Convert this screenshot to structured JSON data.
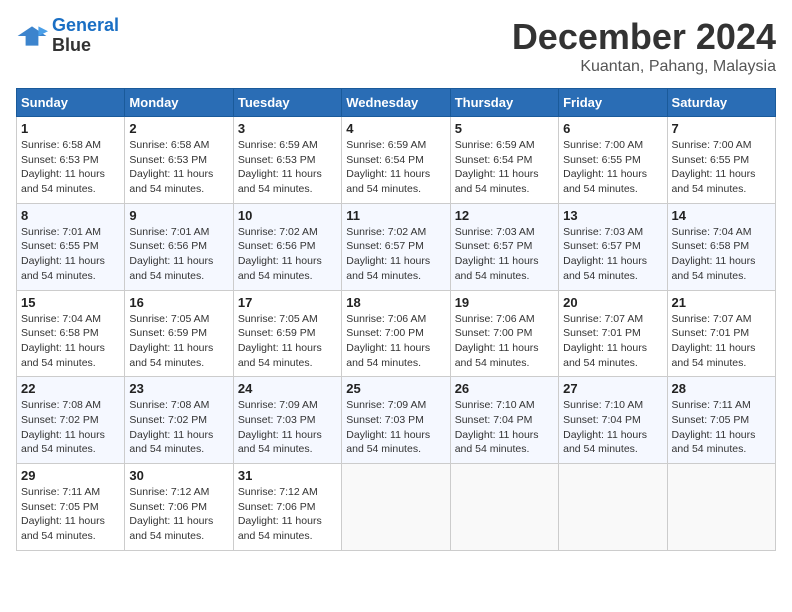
{
  "logo": {
    "line1": "General",
    "line2": "Blue"
  },
  "title": "December 2024",
  "location": "Kuantan, Pahang, Malaysia",
  "days_of_week": [
    "Sunday",
    "Monday",
    "Tuesday",
    "Wednesday",
    "Thursday",
    "Friday",
    "Saturday"
  ],
  "weeks": [
    [
      {
        "day": 1,
        "info": "Sunrise: 6:58 AM\nSunset: 6:53 PM\nDaylight: 11 hours\nand 54 minutes."
      },
      {
        "day": 2,
        "info": "Sunrise: 6:58 AM\nSunset: 6:53 PM\nDaylight: 11 hours\nand 54 minutes."
      },
      {
        "day": 3,
        "info": "Sunrise: 6:59 AM\nSunset: 6:53 PM\nDaylight: 11 hours\nand 54 minutes."
      },
      {
        "day": 4,
        "info": "Sunrise: 6:59 AM\nSunset: 6:54 PM\nDaylight: 11 hours\nand 54 minutes."
      },
      {
        "day": 5,
        "info": "Sunrise: 6:59 AM\nSunset: 6:54 PM\nDaylight: 11 hours\nand 54 minutes."
      },
      {
        "day": 6,
        "info": "Sunrise: 7:00 AM\nSunset: 6:55 PM\nDaylight: 11 hours\nand 54 minutes."
      },
      {
        "day": 7,
        "info": "Sunrise: 7:00 AM\nSunset: 6:55 PM\nDaylight: 11 hours\nand 54 minutes."
      }
    ],
    [
      {
        "day": 8,
        "info": "Sunrise: 7:01 AM\nSunset: 6:55 PM\nDaylight: 11 hours\nand 54 minutes."
      },
      {
        "day": 9,
        "info": "Sunrise: 7:01 AM\nSunset: 6:56 PM\nDaylight: 11 hours\nand 54 minutes."
      },
      {
        "day": 10,
        "info": "Sunrise: 7:02 AM\nSunset: 6:56 PM\nDaylight: 11 hours\nand 54 minutes."
      },
      {
        "day": 11,
        "info": "Sunrise: 7:02 AM\nSunset: 6:57 PM\nDaylight: 11 hours\nand 54 minutes."
      },
      {
        "day": 12,
        "info": "Sunrise: 7:03 AM\nSunset: 6:57 PM\nDaylight: 11 hours\nand 54 minutes."
      },
      {
        "day": 13,
        "info": "Sunrise: 7:03 AM\nSunset: 6:57 PM\nDaylight: 11 hours\nand 54 minutes."
      },
      {
        "day": 14,
        "info": "Sunrise: 7:04 AM\nSunset: 6:58 PM\nDaylight: 11 hours\nand 54 minutes."
      }
    ],
    [
      {
        "day": 15,
        "info": "Sunrise: 7:04 AM\nSunset: 6:58 PM\nDaylight: 11 hours\nand 54 minutes."
      },
      {
        "day": 16,
        "info": "Sunrise: 7:05 AM\nSunset: 6:59 PM\nDaylight: 11 hours\nand 54 minutes."
      },
      {
        "day": 17,
        "info": "Sunrise: 7:05 AM\nSunset: 6:59 PM\nDaylight: 11 hours\nand 54 minutes."
      },
      {
        "day": 18,
        "info": "Sunrise: 7:06 AM\nSunset: 7:00 PM\nDaylight: 11 hours\nand 54 minutes."
      },
      {
        "day": 19,
        "info": "Sunrise: 7:06 AM\nSunset: 7:00 PM\nDaylight: 11 hours\nand 54 minutes."
      },
      {
        "day": 20,
        "info": "Sunrise: 7:07 AM\nSunset: 7:01 PM\nDaylight: 11 hours\nand 54 minutes."
      },
      {
        "day": 21,
        "info": "Sunrise: 7:07 AM\nSunset: 7:01 PM\nDaylight: 11 hours\nand 54 minutes."
      }
    ],
    [
      {
        "day": 22,
        "info": "Sunrise: 7:08 AM\nSunset: 7:02 PM\nDaylight: 11 hours\nand 54 minutes."
      },
      {
        "day": 23,
        "info": "Sunrise: 7:08 AM\nSunset: 7:02 PM\nDaylight: 11 hours\nand 54 minutes."
      },
      {
        "day": 24,
        "info": "Sunrise: 7:09 AM\nSunset: 7:03 PM\nDaylight: 11 hours\nand 54 minutes."
      },
      {
        "day": 25,
        "info": "Sunrise: 7:09 AM\nSunset: 7:03 PM\nDaylight: 11 hours\nand 54 minutes."
      },
      {
        "day": 26,
        "info": "Sunrise: 7:10 AM\nSunset: 7:04 PM\nDaylight: 11 hours\nand 54 minutes."
      },
      {
        "day": 27,
        "info": "Sunrise: 7:10 AM\nSunset: 7:04 PM\nDaylight: 11 hours\nand 54 minutes."
      },
      {
        "day": 28,
        "info": "Sunrise: 7:11 AM\nSunset: 7:05 PM\nDaylight: 11 hours\nand 54 minutes."
      }
    ],
    [
      {
        "day": 29,
        "info": "Sunrise: 7:11 AM\nSunset: 7:05 PM\nDaylight: 11 hours\nand 54 minutes."
      },
      {
        "day": 30,
        "info": "Sunrise: 7:12 AM\nSunset: 7:06 PM\nDaylight: 11 hours\nand 54 minutes."
      },
      {
        "day": 31,
        "info": "Sunrise: 7:12 AM\nSunset: 7:06 PM\nDaylight: 11 hours\nand 54 minutes."
      },
      null,
      null,
      null,
      null
    ]
  ]
}
